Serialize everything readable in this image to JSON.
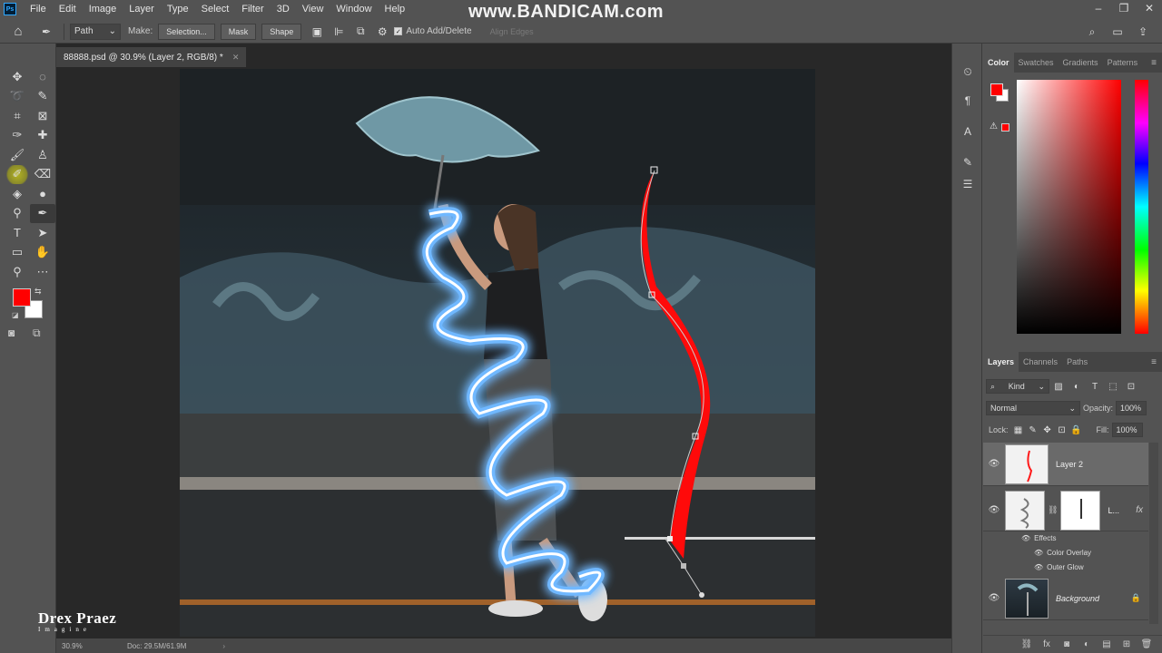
{
  "menu": [
    "File",
    "Edit",
    "Image",
    "Layer",
    "Type",
    "Select",
    "Filter",
    "3D",
    "View",
    "Window",
    "Help"
  ],
  "app_logo": "Ps",
  "watermark": "www.BANDICAM.com",
  "window_controls": [
    "minimize-icon",
    "restore-icon",
    "close-icon"
  ],
  "options": {
    "mode_value": "Path",
    "make_label": "Make:",
    "selection_btn": "Selection...",
    "mask_btn": "Mask",
    "shape_btn": "Shape",
    "auto_add_delete": "Auto Add/Delete",
    "align_edges": "Align Edges"
  },
  "document": {
    "tab_title": "88888.psd @ 30.9% (Layer 2, RGB/8) *",
    "zoom": "30.9%",
    "doc_size": "Doc: 29.5M/61.9M"
  },
  "signature": {
    "name": "Drex Praez",
    "sub": "Imagine"
  },
  "color_panel": {
    "tabs": [
      "Color",
      "Swatches",
      "Gradients",
      "Patterns"
    ],
    "active_tab": "Color",
    "foreground": "#ff0000",
    "background": "#ffffff"
  },
  "layers_panel": {
    "tabs": [
      "Layers",
      "Channels",
      "Paths"
    ],
    "active_tab": "Layers",
    "filter_kind": "Kind",
    "blend_mode": "Normal",
    "opacity_label": "Opacity:",
    "opacity_value": "100%",
    "lock_label": "Lock:",
    "fill_label": "Fill:",
    "fill_value": "100%",
    "layers": [
      {
        "name": "Layer 2",
        "selected": true
      },
      {
        "name": "L...",
        "fx": "fx",
        "effects_label": "Effects",
        "effects": [
          "Color Overlay",
          "Outer Glow"
        ]
      },
      {
        "name": "Background",
        "locked": true
      }
    ]
  }
}
